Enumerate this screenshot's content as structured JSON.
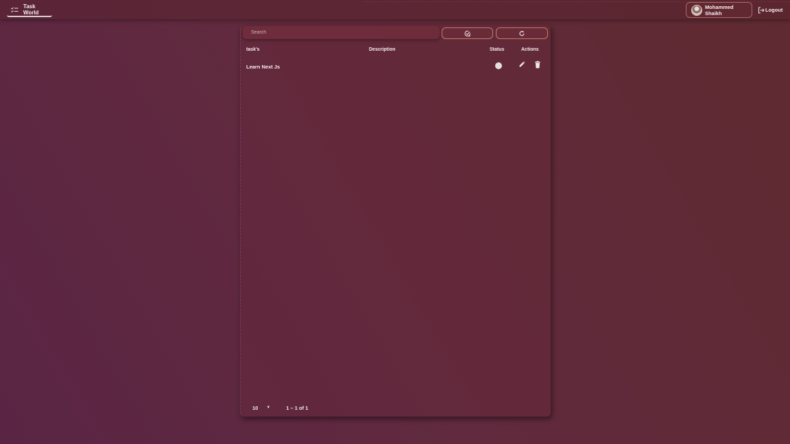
{
  "header": {
    "brand": "Task World",
    "user_name": "Mohammed Shaikh",
    "logout_label": "Logout"
  },
  "toolbar": {
    "search_placeholder": "Search",
    "search_value": ""
  },
  "table": {
    "columns": [
      "task's",
      "Description",
      "Status",
      "Actions"
    ],
    "rows": [
      {
        "task": "Learn Next Js",
        "description": "",
        "status": "pending"
      }
    ]
  },
  "pagination": {
    "rows_per_page": "10",
    "range": "1 – 1 of 1"
  },
  "colors": {
    "accent_border": "#e1968a",
    "status_dot": "#e4dfe0"
  }
}
